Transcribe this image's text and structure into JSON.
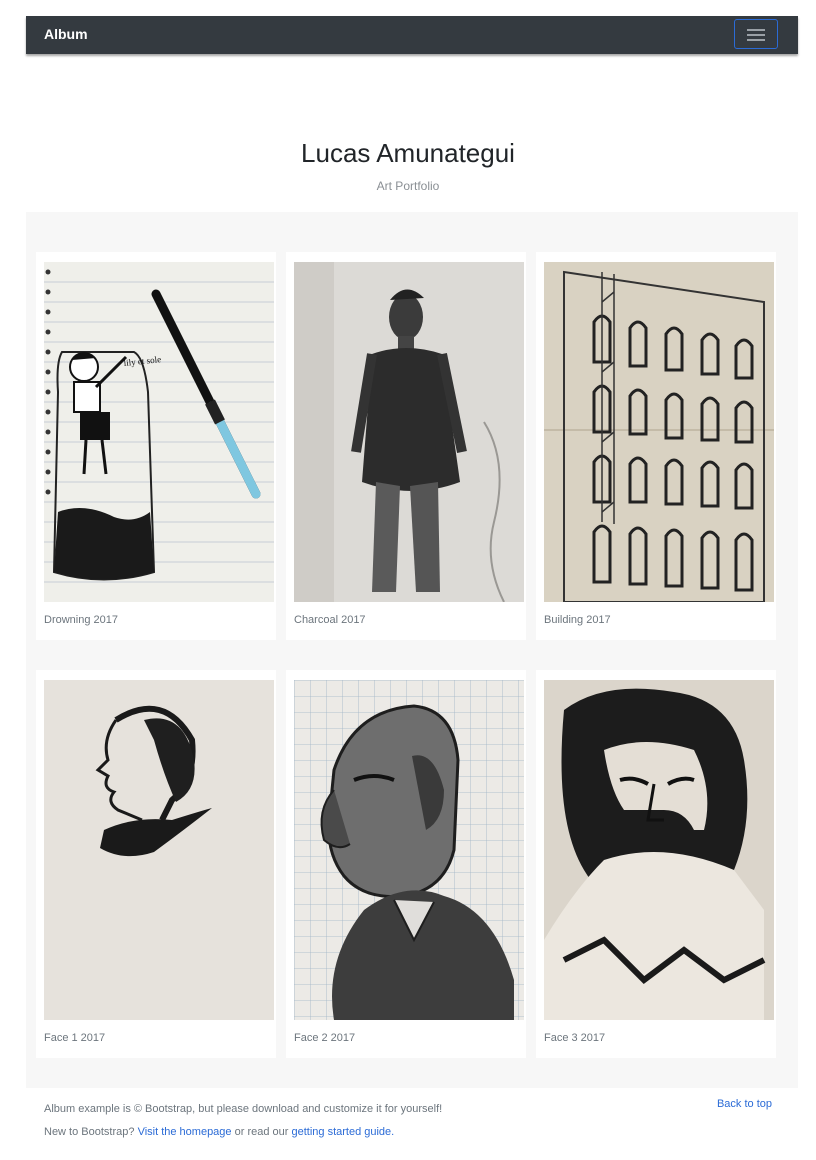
{
  "navbar": {
    "brand": "Album",
    "menu_icon": "hamburger-icon"
  },
  "jumbotron": {
    "title": "Lucas Amunategui",
    "subtitle": "Art Portfolio"
  },
  "cards": [
    {
      "caption": "Drowning 2017"
    },
    {
      "caption": "Charcoal 2017"
    },
    {
      "caption": "Building 2017"
    },
    {
      "caption": "Face 1 2017"
    },
    {
      "caption": "Face 2 2017"
    },
    {
      "caption": "Face 3 2017"
    }
  ],
  "footer": {
    "line1": "Album example is © Bootstrap, but please download and customize it for yourself!",
    "line2_prefix": "New to Bootstrap?",
    "homepage_link": "Visit the homepage",
    "line2_middle": "or read our",
    "guide_link": "getting started guide.",
    "back_to_top": "Back to top"
  },
  "colors": {
    "navbar_bg": "#343a40",
    "link": "#2b6bd6",
    "album_bg": "#f7f7f7"
  }
}
